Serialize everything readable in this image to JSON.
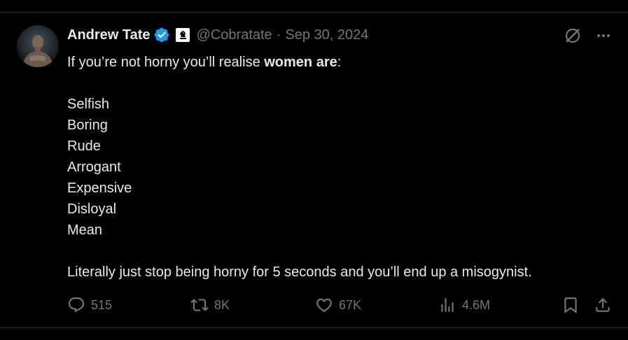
{
  "tweet": {
    "author": "Andrew Tate",
    "handle": "@Cobratate",
    "separator": "·",
    "date": "Sep 30, 2024",
    "intro_pre": "If you’re not horny you’ll realise ",
    "intro_bold": "women are",
    "intro_post": ":",
    "list": [
      "Selfish",
      "Boring",
      "Rude",
      "Arrogant",
      "Expensive",
      "Disloyal",
      "Mean"
    ],
    "closing": "Literally just stop being horny for 5 seconds and you’ll end up a misogynist."
  },
  "stats": {
    "replies": "515",
    "reposts": "8K",
    "likes": "67K",
    "views": "4.6M"
  },
  "icons": {
    "verified": "verified-badge-icon",
    "affiliate": "chess-knight-icon",
    "grok": "grok-icon",
    "more": "more-icon",
    "reply": "reply-icon",
    "repost": "repost-icon",
    "like": "heart-icon",
    "views": "views-icon",
    "bookmark": "bookmark-icon",
    "share": "share-icon"
  },
  "colors": {
    "background": "#000000",
    "text": "#e7e9ea",
    "muted": "#71767b",
    "verified": "#1d9bf0",
    "divider": "#2f3336"
  }
}
